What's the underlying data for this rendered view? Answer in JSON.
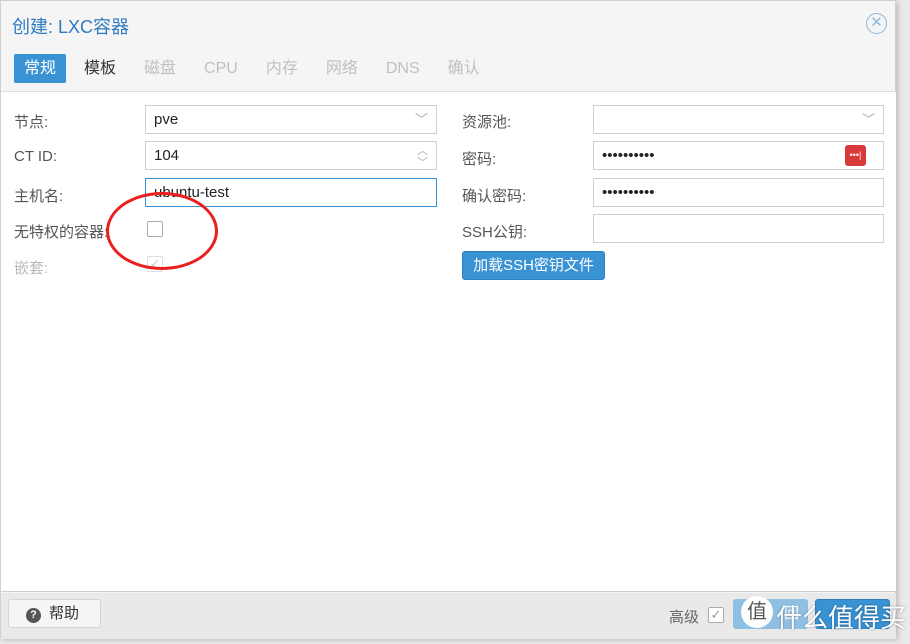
{
  "window": {
    "title": "创建: LXC容器",
    "close_icon": "close-circle-icon"
  },
  "tabs": [
    {
      "label": "常规",
      "state": "active"
    },
    {
      "label": "模板",
      "state": "normal"
    },
    {
      "label": "磁盘",
      "state": "disabled"
    },
    {
      "label": "CPU",
      "state": "disabled"
    },
    {
      "label": "内存",
      "state": "disabled"
    },
    {
      "label": "网络",
      "state": "disabled"
    },
    {
      "label": "DNS",
      "state": "disabled"
    },
    {
      "label": "确认",
      "state": "disabled"
    }
  ],
  "left": {
    "node_label": "节点:",
    "node_value": "pve",
    "ctid_label": "CT ID:",
    "ctid_value": "104",
    "hostname_label": "主机名:",
    "hostname_value": "ubuntu-test",
    "unpriv_label": "无特权的容器:",
    "unpriv_checked": false,
    "nesting_label": "嵌套:",
    "nesting_checked": true
  },
  "right": {
    "pool_label": "资源池:",
    "pool_value": "",
    "password_label": "密码:",
    "password_value": "••••••••••",
    "confirm_label": "确认密码:",
    "confirm_value": "••••••••••",
    "ssh_label": "SSH公钥:",
    "ssh_value": "",
    "load_ssh_button": "加载SSH密钥文件"
  },
  "footer": {
    "help": "帮助",
    "advanced_label": "高级",
    "advanced_checked": true,
    "back_button": "回",
    "next_button": ""
  },
  "watermark": {
    "logo": "值",
    "text": "什么值得买"
  },
  "colors": {
    "accent": "#3892d4",
    "annotation": "#e82020"
  }
}
